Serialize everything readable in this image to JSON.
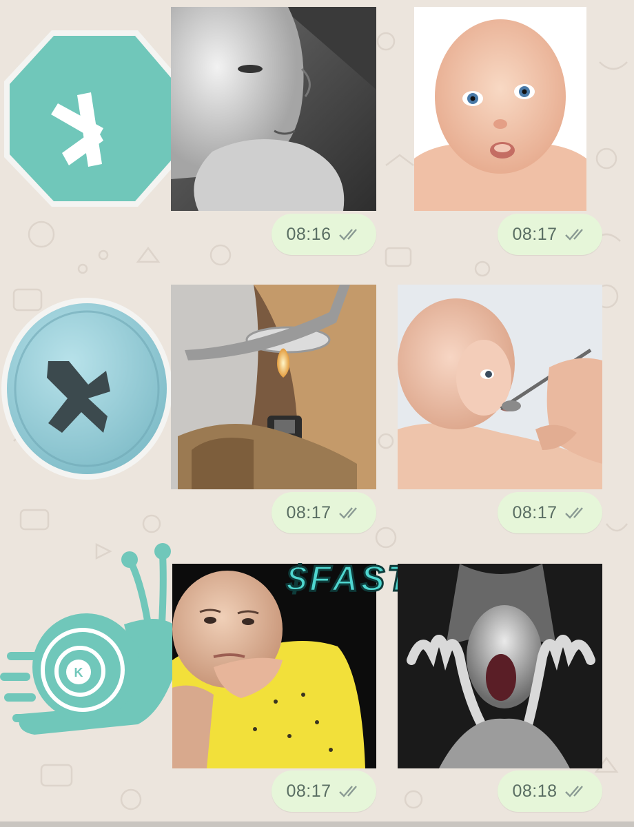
{
  "chat": {
    "wallpaper_color": "#ece5dd",
    "bubble_color": "#e6f6d9",
    "accent_color": "#70c7ba",
    "rows": [
      {
        "sticker": "kaspa-logo-hexagon-icon",
        "messages": [
          {
            "media": "baby-thinking-bw-photo",
            "time": "08:16",
            "status": "double-check-icon"
          },
          {
            "media": "baby-surprised-photo",
            "time": "08:17",
            "status": "double-check-icon"
          }
        ]
      },
      {
        "sticker": "kaspa-pill-icon",
        "messages": [
          {
            "media": "spoon-lighter-photo",
            "time": "08:17",
            "status": "double-check-icon"
          },
          {
            "media": "baby-spoon-feeding-photo",
            "time": "08:17",
            "status": "double-check-icon"
          }
        ]
      },
      {
        "sticker": "kaspa-snail-icon",
        "caption": "$FAST",
        "messages": [
          {
            "media": "baby-yellow-shirt-photo",
            "time": "08:17",
            "status": "double-check-icon"
          },
          {
            "media": "screaming-baby-negative-photo",
            "time": "08:18",
            "status": "double-check-icon"
          }
        ]
      }
    ]
  }
}
